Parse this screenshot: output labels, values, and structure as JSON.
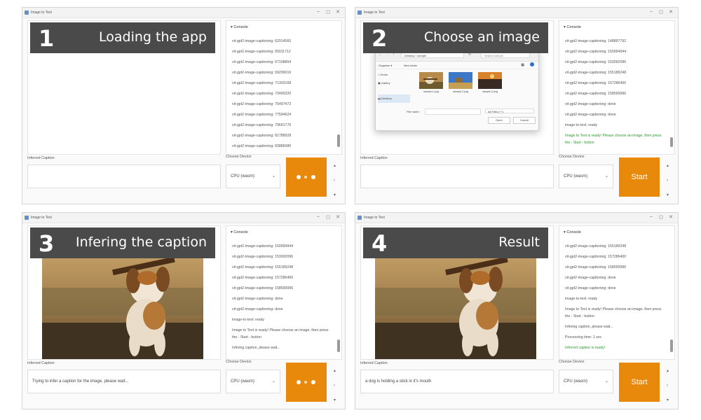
{
  "window": {
    "title": "Image to Text"
  },
  "panels": [
    {
      "step_number": "1",
      "step_label": "Loading the app",
      "console_header": "▾ Console",
      "console_lines": [
        "vit-gpt2-image-captioning: 62914560",
        "vit-gpt2-image-captioning: 65011712",
        "vit-gpt2-image-captioning: 67108864",
        "vit-gpt2-image-captioning: 69206016",
        "vit-gpt2-image-captioning: 71303168",
        "vit-gpt2-image-captioning: 73400320",
        "vit-gpt2-image-captioning: 75497472",
        "vit-gpt2-image-captioning: 77594624",
        "vit-gpt2-image-captioning: 79691776",
        "vit-gpt2-image-captioning: 81788928",
        "vit-gpt2-image-captioning: 83886080"
      ],
      "caption_label": "Inferred Caption",
      "caption_value": "",
      "device_label": "Choose Device",
      "device_value": "CPU (wasm)",
      "button_state": "loading"
    },
    {
      "step_number": "2",
      "step_label": "Choose an image",
      "console_header": "▾ Console",
      "console_lines": [
        "vit-gpt2-image-captioning: 148897792",
        "vit-gpt2-image-captioning: 150994944",
        "vit-gpt2-image-captioning: 153092096",
        "vit-gpt2-image-captioning: 155189248",
        "vit-gpt2-image-captioning: 157286400",
        "vit-gpt2-image-captioning: 158599996",
        "vit-gpt2-image-captioning: done",
        "vit-gpt2-image-captioning: done",
        "image-to-text: ready"
      ],
      "console_highlight": "Image to Text is ready! Please choose an image, then press the - Start - button",
      "caption_label": "Inferred Caption",
      "caption_value": "",
      "device_label": "Choose Device",
      "device_value": "CPU (wasm)",
      "button_label": "Start",
      "dialog": {
        "path": "Desktop › sample",
        "search_placeholder": "Search sample",
        "organize": "Organize ▾",
        "new_folder": "New folder",
        "nav_items": [
          "Home",
          "Gallery",
          "Desktop"
        ],
        "files": [
          "sample-1.png",
          "sample-2.png",
          "sample-3.png"
        ],
        "filename_label": "File name:",
        "filetype": "All Files (*.*)",
        "open_button": "Open",
        "cancel_button": "Cancel"
      }
    },
    {
      "step_number": "3",
      "step_label": "Infering the caption",
      "console_header": "▾ Console",
      "console_lines": [
        "vit-gpt2-image-captioning: 150994944",
        "vit-gpt2-image-captioning: 153092096",
        "vit-gpt2-image-captioning: 155189248",
        "vit-gpt2-image-captioning: 157286400",
        "vit-gpt2-image-captioning: 158599996",
        "vit-gpt2-image-captioning: done",
        "vit-gpt2-image-captioning: done",
        "image-to-text: ready"
      ],
      "console_wrap": "Image to Text is ready! Please choose an image, then press the - Start - button",
      "console_last": "Infering caption, please wait...",
      "caption_label": "Inferred Caption",
      "caption_value": "Trying to infer a caption for the image, please wait...",
      "device_label": "Choose Device",
      "device_value": "CPU (wasm)",
      "button_state": "loading"
    },
    {
      "step_number": "4",
      "step_label": "Result",
      "console_header": "▾ Console",
      "console_lines": [
        "vit-gpt2-image-captioning: 155189248",
        "vit-gpt2-image-captioning: 157286400",
        "vit-gpt2-image-captioning: 158599996",
        "vit-gpt2-image-captioning: done",
        "vit-gpt2-image-captioning: done",
        "image-to-text: ready"
      ],
      "console_wrap": "Image to Text is ready! Please choose an image, then press the - Start - button",
      "console_after": [
        "Infering caption, please wait...",
        "Processing time: 1 sec"
      ],
      "console_done": "Inferred caption is ready!",
      "caption_label": "Inferred Caption",
      "caption_value": "a dog is holding a stick in it's mouth",
      "device_label": "Choose Device",
      "device_value": "CPU (wasm)",
      "button_label": "Start"
    }
  ],
  "colors": {
    "accent": "#e8890c",
    "console_green": "#2b9a2b",
    "step_banner": "#4a4a4a"
  },
  "icons": {
    "minimize": "–",
    "maximize": "◻",
    "close": "✕",
    "chevron": "⌄",
    "scroll_up": "▴",
    "scroll_down": "▾"
  }
}
